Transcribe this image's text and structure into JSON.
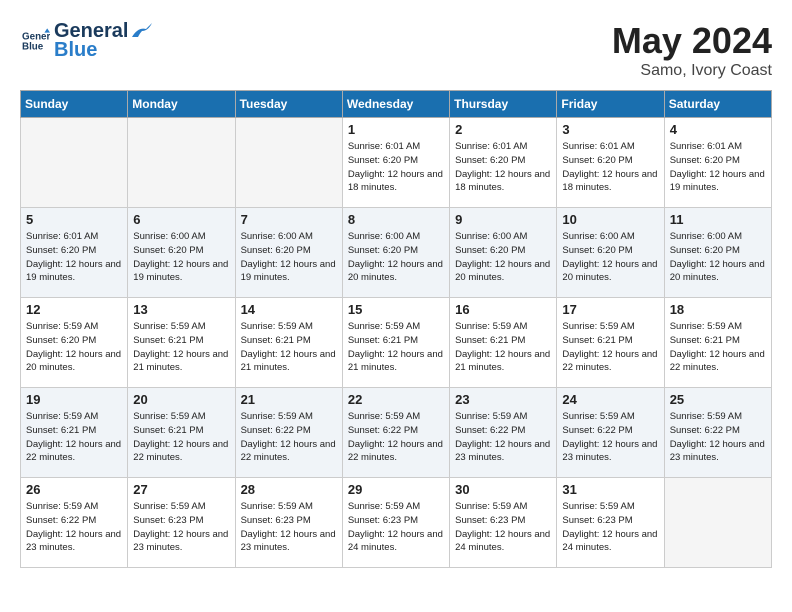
{
  "header": {
    "logo_line1": "General",
    "logo_line2": "Blue",
    "month_year": "May 2024",
    "location": "Samo, Ivory Coast"
  },
  "weekdays": [
    "Sunday",
    "Monday",
    "Tuesday",
    "Wednesday",
    "Thursday",
    "Friday",
    "Saturday"
  ],
  "weeks": [
    [
      {
        "day": "",
        "empty": true
      },
      {
        "day": "",
        "empty": true
      },
      {
        "day": "",
        "empty": true
      },
      {
        "day": "1",
        "sunrise": "6:01 AM",
        "sunset": "6:20 PM",
        "daylight": "12 hours and 18 minutes."
      },
      {
        "day": "2",
        "sunrise": "6:01 AM",
        "sunset": "6:20 PM",
        "daylight": "12 hours and 18 minutes."
      },
      {
        "day": "3",
        "sunrise": "6:01 AM",
        "sunset": "6:20 PM",
        "daylight": "12 hours and 18 minutes."
      },
      {
        "day": "4",
        "sunrise": "6:01 AM",
        "sunset": "6:20 PM",
        "daylight": "12 hours and 19 minutes."
      }
    ],
    [
      {
        "day": "5",
        "sunrise": "6:01 AM",
        "sunset": "6:20 PM",
        "daylight": "12 hours and 19 minutes."
      },
      {
        "day": "6",
        "sunrise": "6:00 AM",
        "sunset": "6:20 PM",
        "daylight": "12 hours and 19 minutes."
      },
      {
        "day": "7",
        "sunrise": "6:00 AM",
        "sunset": "6:20 PM",
        "daylight": "12 hours and 19 minutes."
      },
      {
        "day": "8",
        "sunrise": "6:00 AM",
        "sunset": "6:20 PM",
        "daylight": "12 hours and 20 minutes."
      },
      {
        "day": "9",
        "sunrise": "6:00 AM",
        "sunset": "6:20 PM",
        "daylight": "12 hours and 20 minutes."
      },
      {
        "day": "10",
        "sunrise": "6:00 AM",
        "sunset": "6:20 PM",
        "daylight": "12 hours and 20 minutes."
      },
      {
        "day": "11",
        "sunrise": "6:00 AM",
        "sunset": "6:20 PM",
        "daylight": "12 hours and 20 minutes."
      }
    ],
    [
      {
        "day": "12",
        "sunrise": "5:59 AM",
        "sunset": "6:20 PM",
        "daylight": "12 hours and 20 minutes."
      },
      {
        "day": "13",
        "sunrise": "5:59 AM",
        "sunset": "6:21 PM",
        "daylight": "12 hours and 21 minutes."
      },
      {
        "day": "14",
        "sunrise": "5:59 AM",
        "sunset": "6:21 PM",
        "daylight": "12 hours and 21 minutes."
      },
      {
        "day": "15",
        "sunrise": "5:59 AM",
        "sunset": "6:21 PM",
        "daylight": "12 hours and 21 minutes."
      },
      {
        "day": "16",
        "sunrise": "5:59 AM",
        "sunset": "6:21 PM",
        "daylight": "12 hours and 21 minutes."
      },
      {
        "day": "17",
        "sunrise": "5:59 AM",
        "sunset": "6:21 PM",
        "daylight": "12 hours and 22 minutes."
      },
      {
        "day": "18",
        "sunrise": "5:59 AM",
        "sunset": "6:21 PM",
        "daylight": "12 hours and 22 minutes."
      }
    ],
    [
      {
        "day": "19",
        "sunrise": "5:59 AM",
        "sunset": "6:21 PM",
        "daylight": "12 hours and 22 minutes."
      },
      {
        "day": "20",
        "sunrise": "5:59 AM",
        "sunset": "6:21 PM",
        "daylight": "12 hours and 22 minutes."
      },
      {
        "day": "21",
        "sunrise": "5:59 AM",
        "sunset": "6:22 PM",
        "daylight": "12 hours and 22 minutes."
      },
      {
        "day": "22",
        "sunrise": "5:59 AM",
        "sunset": "6:22 PM",
        "daylight": "12 hours and 22 minutes."
      },
      {
        "day": "23",
        "sunrise": "5:59 AM",
        "sunset": "6:22 PM",
        "daylight": "12 hours and 23 minutes."
      },
      {
        "day": "24",
        "sunrise": "5:59 AM",
        "sunset": "6:22 PM",
        "daylight": "12 hours and 23 minutes."
      },
      {
        "day": "25",
        "sunrise": "5:59 AM",
        "sunset": "6:22 PM",
        "daylight": "12 hours and 23 minutes."
      }
    ],
    [
      {
        "day": "26",
        "sunrise": "5:59 AM",
        "sunset": "6:22 PM",
        "daylight": "12 hours and 23 minutes."
      },
      {
        "day": "27",
        "sunrise": "5:59 AM",
        "sunset": "6:23 PM",
        "daylight": "12 hours and 23 minutes."
      },
      {
        "day": "28",
        "sunrise": "5:59 AM",
        "sunset": "6:23 PM",
        "daylight": "12 hours and 23 minutes."
      },
      {
        "day": "29",
        "sunrise": "5:59 AM",
        "sunset": "6:23 PM",
        "daylight": "12 hours and 24 minutes."
      },
      {
        "day": "30",
        "sunrise": "5:59 AM",
        "sunset": "6:23 PM",
        "daylight": "12 hours and 24 minutes."
      },
      {
        "day": "31",
        "sunrise": "5:59 AM",
        "sunset": "6:23 PM",
        "daylight": "12 hours and 24 minutes."
      },
      {
        "day": "",
        "empty": true
      }
    ]
  ]
}
